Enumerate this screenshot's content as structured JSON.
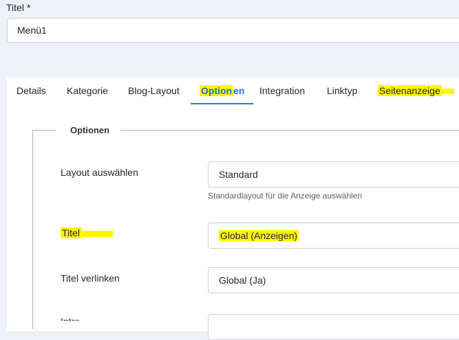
{
  "form": {
    "title_label": "Titel *",
    "title_value": "Menü1"
  },
  "tabs": [
    {
      "label": "Details"
    },
    {
      "label": "Kategorie"
    },
    {
      "label": "Blog-Layout"
    },
    {
      "label_highlighted": "Option",
      "label_rest": "en"
    },
    {
      "label": "Integration"
    },
    {
      "label": "Linktyp"
    },
    {
      "label": "Seitenanzeige"
    }
  ],
  "options": {
    "legend": "Optionen",
    "fields": [
      {
        "label": "Layout auswählen",
        "value": "Standard",
        "hint": "Standardlayout für die Anzeige auswählen"
      },
      {
        "label": "Titel",
        "value": "Global (Anzeigen)"
      },
      {
        "label": "Titel verlinken",
        "value": "Global (Ja)"
      },
      {
        "label": "Intro"
      }
    ]
  },
  "colors": {
    "highlight": "#fff500",
    "active_tab": "#1f6fd1",
    "page_bg": "#eef2f8"
  }
}
